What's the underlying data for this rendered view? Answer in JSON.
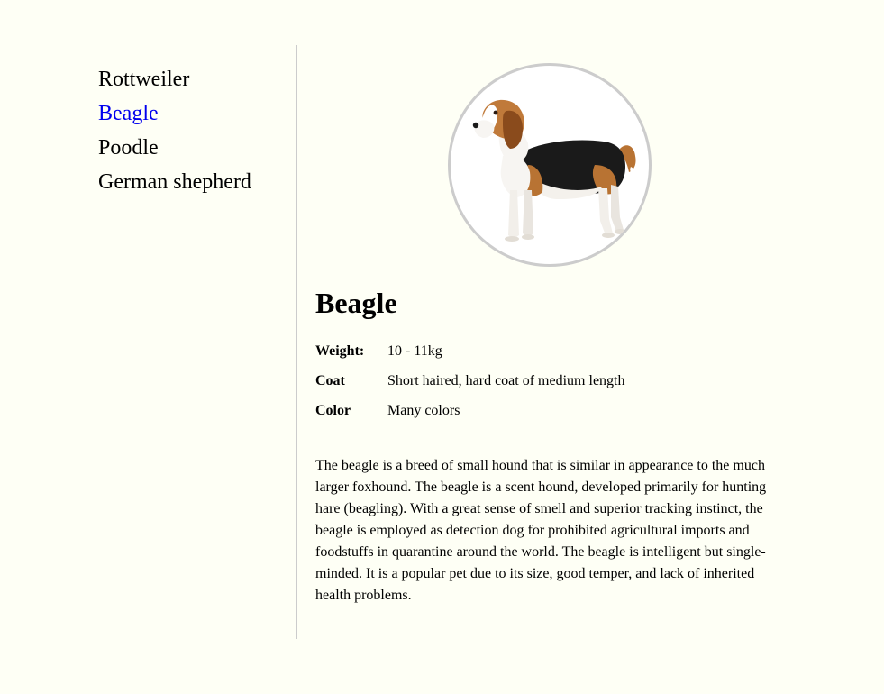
{
  "sidebar": {
    "items": [
      {
        "label": "Rottweiler",
        "active": false
      },
      {
        "label": "Beagle",
        "active": true
      },
      {
        "label": "Poodle",
        "active": false
      },
      {
        "label": "German shepherd",
        "active": false
      }
    ]
  },
  "breed": {
    "name": "Beagle",
    "image_icon": "beagle-dog-photo",
    "facts": [
      {
        "label": "Weight:",
        "value": "10 - 11kg"
      },
      {
        "label": "Coat",
        "value": "Short haired, hard coat of medium length"
      },
      {
        "label": "Color",
        "value": "Many colors"
      }
    ],
    "description": "The beagle is a breed of small hound that is similar in appearance to the much larger foxhound. The beagle is a scent hound, developed primarily for hunting hare (beagling). With a great sense of smell and superior tracking instinct, the beagle is employed as detection dog for prohibited agricultural imports and foodstuffs in quarantine around the world. The beagle is intelligent but single-minded. It is a popular pet due to its size, good temper, and lack of inherited health problems."
  },
  "colors": {
    "background": "#fefff5",
    "active_link": "#0000ee",
    "divider": "#cccccc",
    "photo_border": "#cccccc"
  }
}
